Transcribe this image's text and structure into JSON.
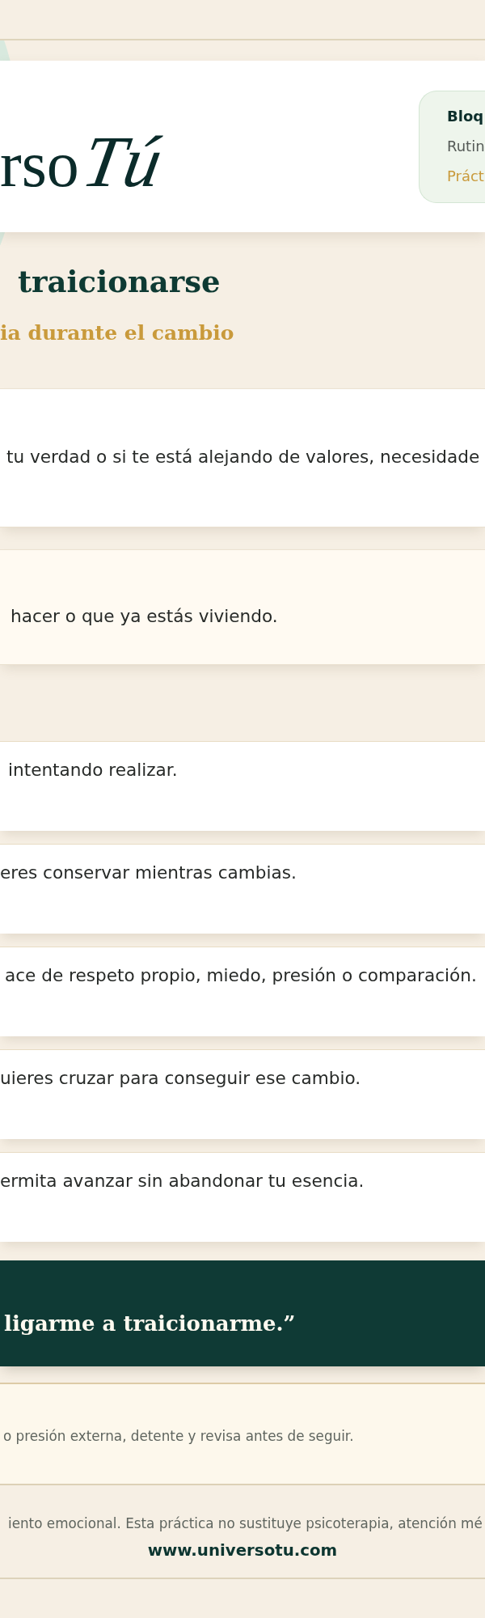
{
  "header": {
    "logo_text": "rso",
    "logo_script": "Tú",
    "info": {
      "title": "Bloq",
      "subtitle": "Rutin",
      "tag": "Práct"
    }
  },
  "title": "traicionarse",
  "subtitle": "ia durante el cambio",
  "intro_cards": [
    {
      "kind": "plain",
      "text": "tu verdad o si te está alejando de valores, necesidade"
    },
    {
      "kind": "highlight",
      "text": "hacer o que ya estás viviendo."
    }
  ],
  "steps": [
    {
      "text": "intentando realizar."
    },
    {
      "text": "eres conservar mientras cambias."
    },
    {
      "text": "ace de respeto propio, miedo, presión o comparación."
    },
    {
      "text": "uieres cruzar para conseguir ese cambio."
    },
    {
      "text": "ermita avanzar sin abandonar tu esencia."
    }
  ],
  "quote": "ligarme a traicionarme.”",
  "note": "o presión externa, detente y revisa antes de seguir.",
  "footer": {
    "disclaimer": "iento emocional. Esta práctica no sustituye psicoterapia, atención mé",
    "url": "www.universotu.com"
  }
}
